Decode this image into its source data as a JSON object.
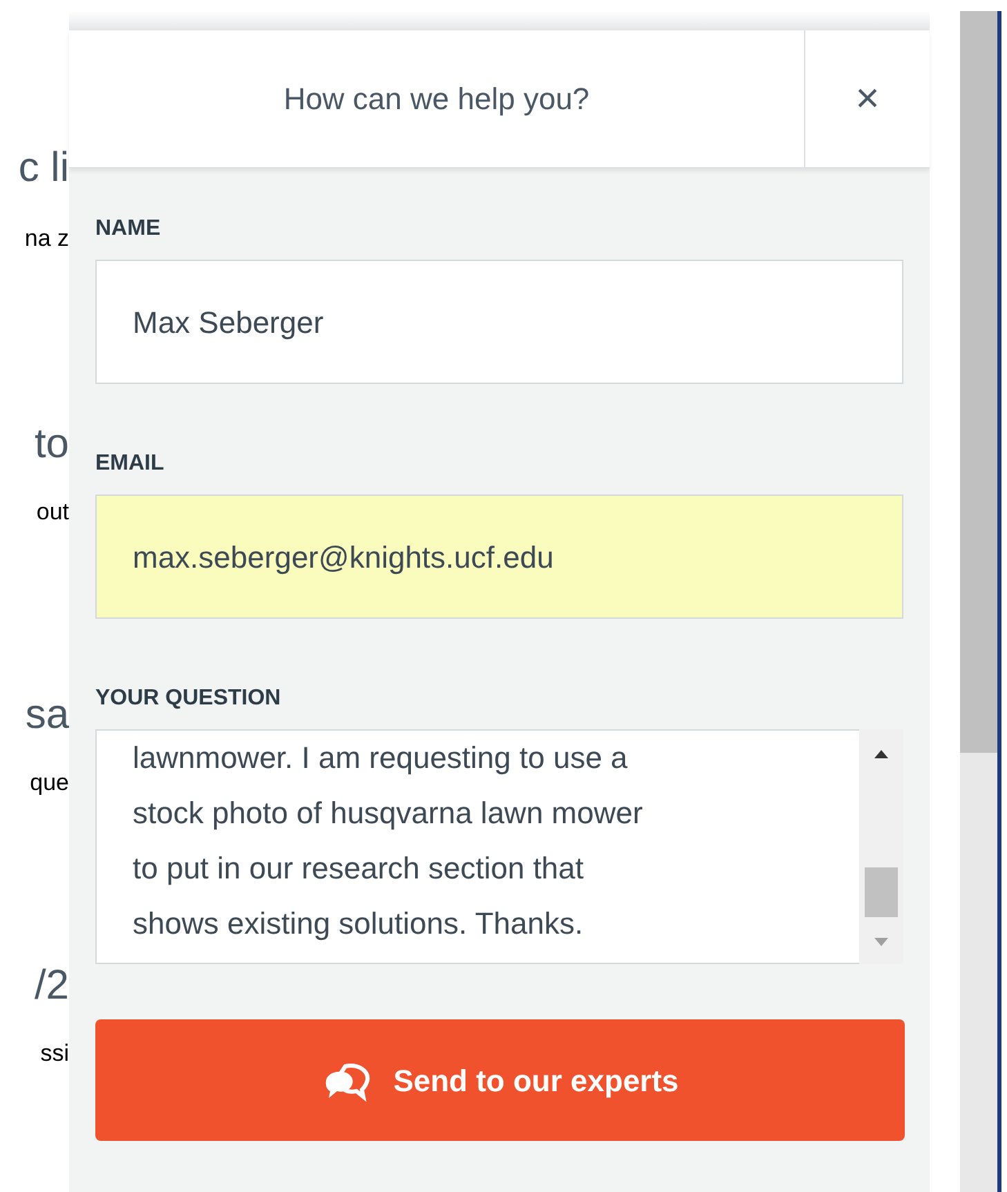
{
  "background_page": {
    "fragments": [
      {
        "text": "c li",
        "kind": "heading"
      },
      {
        "text": "na z",
        "kind": "body"
      },
      {
        "text": "to",
        "kind": "heading"
      },
      {
        "text": "out",
        "kind": "body"
      },
      {
        "text": "sa",
        "kind": "heading"
      },
      {
        "text": "que",
        "kind": "body"
      },
      {
        "text": "/2",
        "kind": "heading"
      },
      {
        "text": "ssi",
        "kind": "body"
      }
    ]
  },
  "panel": {
    "title": "How can we help you?",
    "close": "×",
    "fields": [
      {
        "label": "NAME",
        "value": "Max Seberger",
        "kind": "input",
        "autofilled": false
      },
      {
        "label": "EMAIL",
        "value": "max.seberger@knights.ucf.edu",
        "kind": "input",
        "autofilled": true
      },
      {
        "label": "YOUR QUESTION",
        "value": "lawnmower. I am requesting to use a stock photo of husqvarna lawn mower to put in our research section that shows existing solutions. Thanks.",
        "kind": "textarea",
        "autofilled": false
      }
    ],
    "submit": "Send to our experts"
  }
}
